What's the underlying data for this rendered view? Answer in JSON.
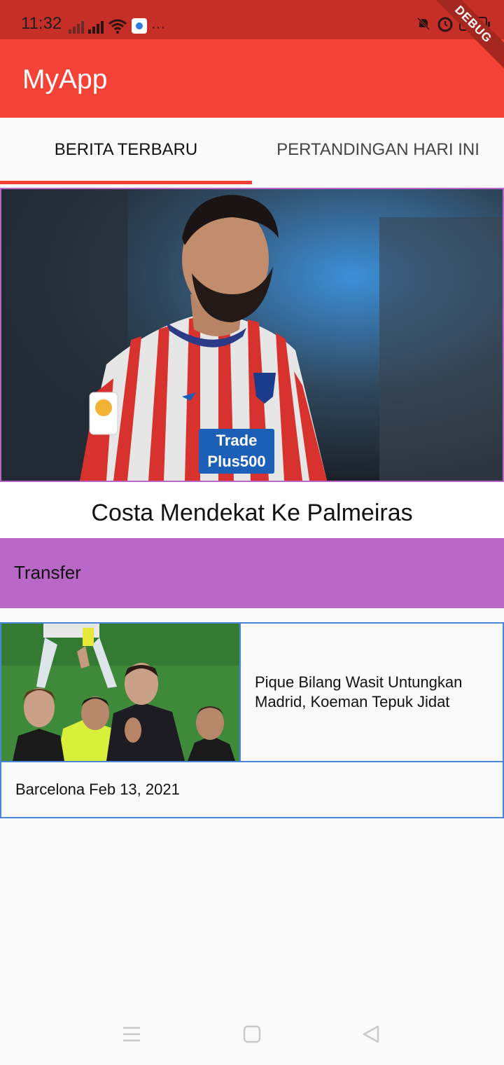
{
  "status_bar": {
    "time": "11:32",
    "more": "···"
  },
  "app_bar": {
    "title": "MyApp",
    "debug_label": "DEBUG"
  },
  "tabs": [
    {
      "label": "BERITA TERBARU",
      "active": true
    },
    {
      "label": "PERTANDINGAN HARI INI",
      "active": false
    }
  ],
  "featured": {
    "title": "Costa Mendekat Ke Palmeiras",
    "category": "Transfer",
    "jersey_sponsor_line1": "Trade",
    "jersey_sponsor_line2": "Plus500"
  },
  "news_list": [
    {
      "title": "Pique Bilang Wasit Untungkan Madrid, Koeman Tepuk Jidat",
      "meta": "Barcelona Feb 13, 2021"
    }
  ],
  "colors": {
    "primary": "#f44336",
    "status_bar": "#c62f27",
    "category": "#ba68c8",
    "card_border": "#4a86d8"
  },
  "icons": {
    "nav_menu": "menu-lines-icon",
    "nav_home": "square-home-icon",
    "nav_back": "triangle-back-icon"
  }
}
